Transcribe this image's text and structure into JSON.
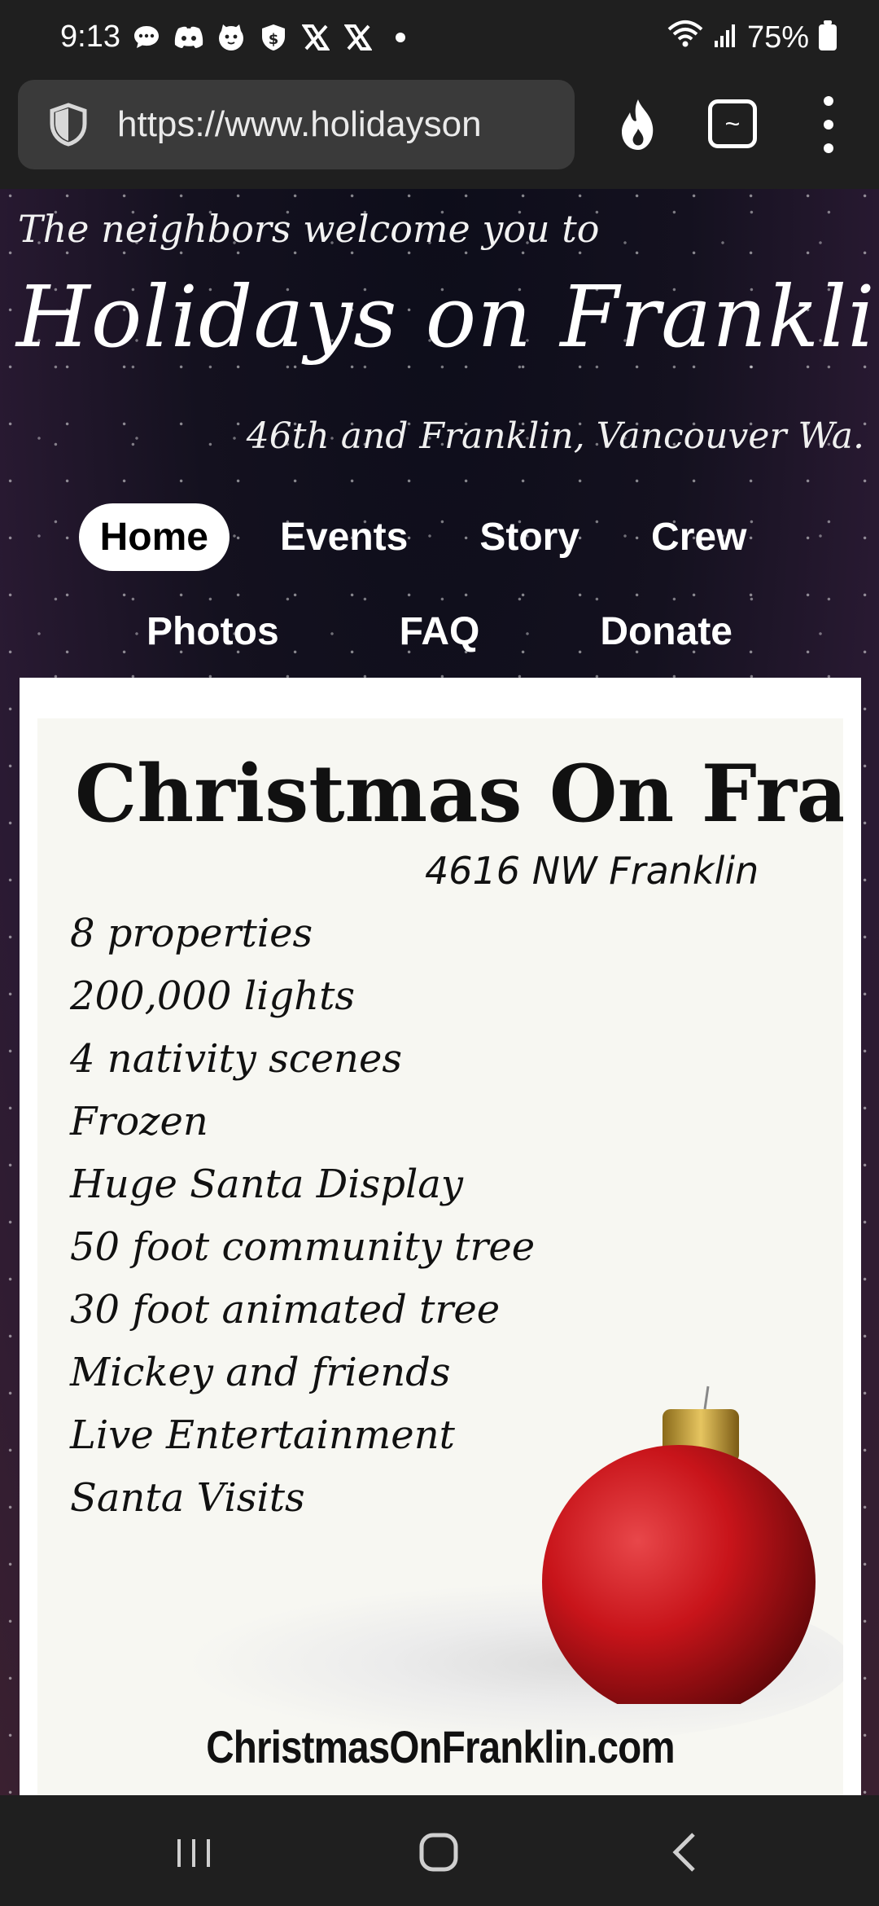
{
  "status_bar": {
    "time": "9:13",
    "battery": "75%",
    "icons": [
      "chat-icon",
      "discord-icon",
      "cat-icon",
      "shield-dollar-icon",
      "x-icon",
      "x-icon",
      "dot-icon",
      "wifi-icon",
      "signal-icon",
      "battery-icon"
    ]
  },
  "browser": {
    "url": "https://www.holidayson",
    "tab_button_glyph": "~"
  },
  "header": {
    "welcome": "The neighbors welcome you to",
    "title": "Holidays on Franklin",
    "subtitle": "46th and Franklin, Vancouver Wa."
  },
  "nav": {
    "row1": [
      {
        "label": "Home",
        "active": true
      },
      {
        "label": "Events",
        "active": false
      },
      {
        "label": "Story",
        "active": false
      },
      {
        "label": "Crew",
        "active": false
      }
    ],
    "row2": [
      {
        "label": "Photos",
        "active": false
      },
      {
        "label": "FAQ",
        "active": false
      },
      {
        "label": "Donate",
        "active": false
      }
    ]
  },
  "poster": {
    "title": "Christmas On Franklin",
    "address": "4616 NW Franklin",
    "features": [
      "8 properties",
      "200,000 lights",
      "4 nativity scenes",
      "Frozen",
      "Huge Santa Display",
      "50 foot community tree",
      "30 foot animated tree",
      "Mickey and friends",
      "Live Entertainment",
      "Santa Visits"
    ],
    "website": "ChristmasOnFranklin.com"
  },
  "colors": {
    "ornament": "#c8141a",
    "ornament_cap": "#c9a23a",
    "system_bar": "#1f1f1f",
    "url_box": "#3a3a3a"
  }
}
